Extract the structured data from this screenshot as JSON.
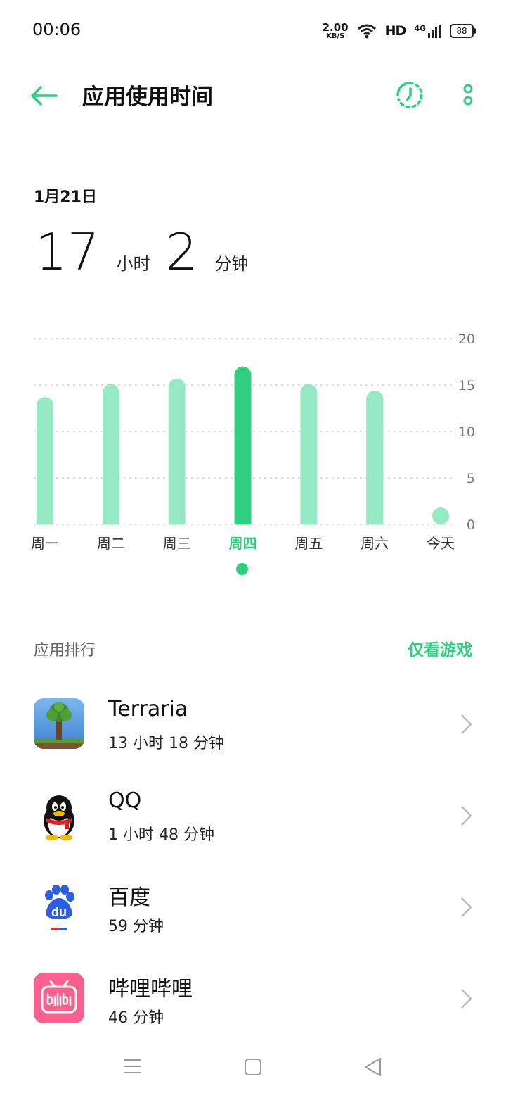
{
  "status_bar": {
    "time": "00:06",
    "net_speed_value": "2.00",
    "net_speed_unit": "KB/S",
    "hd_label": "HD",
    "network": "4G",
    "battery": "88"
  },
  "header": {
    "title": "应用使用时间"
  },
  "summary": {
    "date": "1月21日",
    "hours": "17",
    "hours_unit": "小时",
    "minutes": "2",
    "minutes_unit": "分钟"
  },
  "chart_data": {
    "type": "bar",
    "categories": [
      "周一",
      "周二",
      "周三",
      "周四",
      "周五",
      "周六",
      "今天"
    ],
    "values": [
      13.7,
      15.1,
      15.7,
      17.0,
      15.1,
      14.4,
      1.0
    ],
    "selected_index": 3,
    "ylim": [
      0,
      20
    ],
    "yticks": [
      0,
      5,
      10,
      15,
      20
    ],
    "grid": true,
    "colors": {
      "bar": "#96eac3",
      "selected": "#2ecf80",
      "grid": "#d9d9d9",
      "tick": "#777777"
    }
  },
  "ranking": {
    "label": "应用排行",
    "games_only": "仅看游戏",
    "apps": [
      {
        "name": "Terraria",
        "time": "13 小时 18 分钟",
        "icon": "terraria-icon"
      },
      {
        "name": "QQ",
        "time": "1 小时 48 分钟",
        "icon": "qq-penguin-icon"
      },
      {
        "name": "百度",
        "time": "59 分钟",
        "icon": "baidu-paw-icon"
      },
      {
        "name": "哔哩哔哩",
        "time": "46 分钟",
        "icon": "bilibili-icon"
      }
    ]
  },
  "colors": {
    "accent": "#2ecf80"
  }
}
